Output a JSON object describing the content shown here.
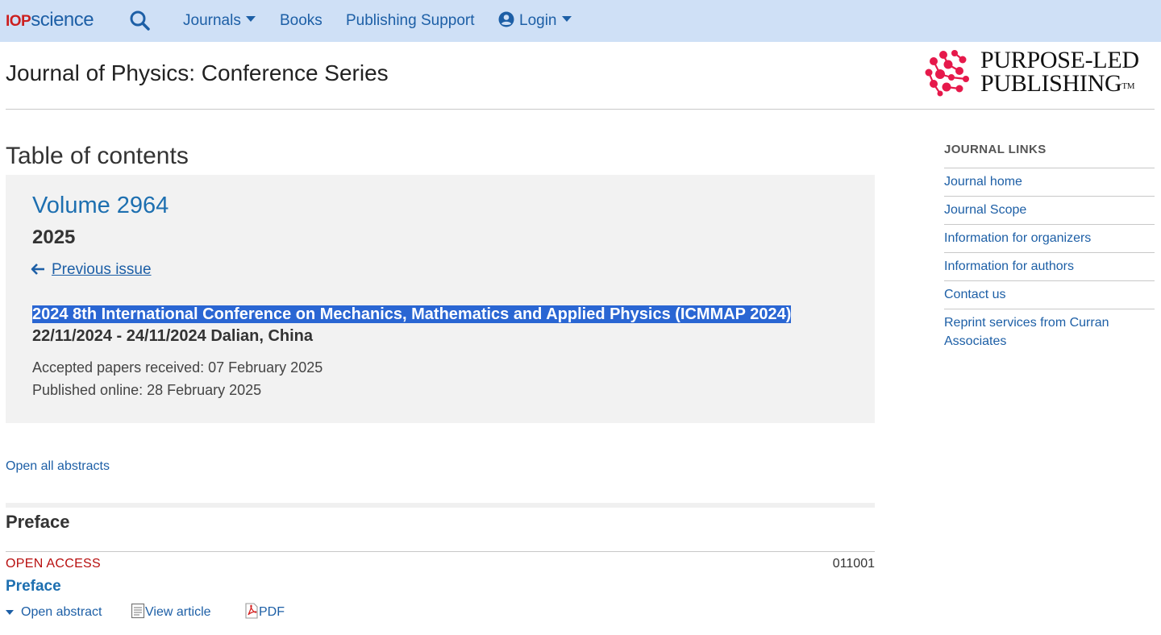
{
  "nav": {
    "brand_iop": "IOP",
    "brand_science": "science",
    "journals": "Journals",
    "books": "Books",
    "publishing_support": "Publishing Support",
    "login": "Login"
  },
  "header": {
    "journal_title": "Journal of Physics: Conference Series",
    "logo_line1": "PURPOSE-LED",
    "logo_line2": "PUBLISHING",
    "logo_tm": "TM"
  },
  "main": {
    "toc_heading": "Table of contents",
    "volume": "Volume 2964",
    "year": "2025",
    "previous_issue": "Previous issue",
    "conference_title": "2024 8th International Conference on Mechanics, Mathematics and Applied Physics (ICMMAP 2024)",
    "conference_dates": "22/11/2024 - 24/11/2024 Dalian, China",
    "accepted": "Accepted papers received: 07 February 2025",
    "published": "Published online: 28 February 2025",
    "open_all_abstracts": "Open all abstracts",
    "section_title": "Preface",
    "article": {
      "access": "OPEN ACCESS",
      "number": "011001",
      "title": "Preface",
      "open_abstract": "Open abstract",
      "view_article": "View article",
      "pdf": "PDF"
    }
  },
  "sidebar": {
    "heading": "JOURNAL LINKS",
    "items": [
      {
        "label": "Journal home"
      },
      {
        "label": "Journal Scope"
      },
      {
        "label": "Information for organizers"
      },
      {
        "label": "Information for authors"
      },
      {
        "label": "Contact us"
      },
      {
        "label": "Reprint services from Curran Associates"
      }
    ]
  },
  "colors": {
    "nav_bg": "#cfe0f6",
    "link": "#1d5fa6",
    "open_access": "#b80f0f",
    "highlight": "#2a66d3",
    "logo_red": "#e6194b"
  },
  "icons": [
    "search-icon",
    "chevron-down-icon",
    "user-circle-icon",
    "arrow-left-icon",
    "document-icon",
    "pdf-icon",
    "purpose-led-logo-icon"
  ]
}
